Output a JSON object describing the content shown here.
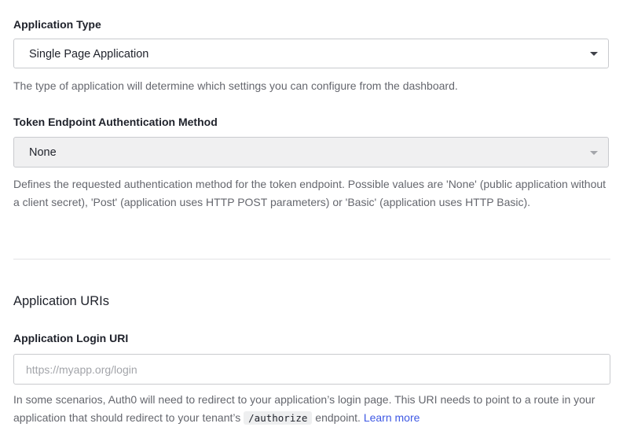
{
  "application_type": {
    "label": "Application Type",
    "selected": "Single Page Application",
    "help": "The type of application will determine which settings you can configure from the dashboard."
  },
  "token_auth": {
    "label": "Token Endpoint Authentication Method",
    "selected": "None",
    "help": "Defines the requested authentication method for the token endpoint. Possible values are 'None' (public application without a client secret), 'Post' (application uses HTTP POST parameters) or 'Basic' (application uses HTTP Basic)."
  },
  "application_uris": {
    "title": "Application URIs",
    "login_uri": {
      "label": "Application Login URI",
      "value": "",
      "placeholder": "https://myapp.org/login",
      "help_before": "In some scenarios, Auth0 will need to redirect to your application’s login page. This URI needs to point to a route in your application that should redirect to your tenant’s ",
      "help_code": "/authorize",
      "help_after": " endpoint. ",
      "learn_more": "Learn more"
    }
  },
  "icons": {
    "application_type_caret": "chevron-down-icon",
    "token_auth_caret": "chevron-down-icon"
  },
  "colors": {
    "link": "#3f59e4",
    "disabled_bg": "#f0f0f1",
    "border": "#c9cace"
  }
}
